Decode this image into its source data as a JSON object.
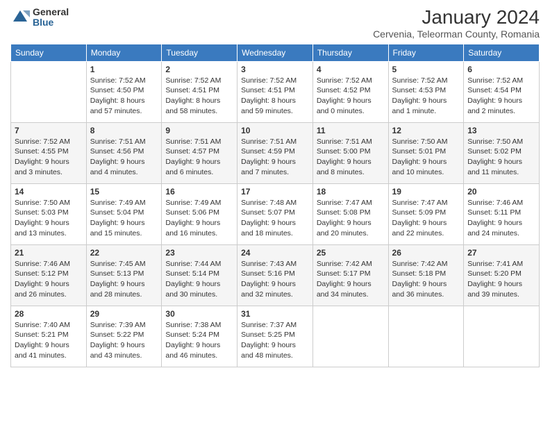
{
  "header": {
    "logo_general": "General",
    "logo_blue": "Blue",
    "main_title": "January 2024",
    "subtitle": "Cervenia, Teleorman County, Romania"
  },
  "calendar": {
    "weekdays": [
      "Sunday",
      "Monday",
      "Tuesday",
      "Wednesday",
      "Thursday",
      "Friday",
      "Saturday"
    ],
    "weeks": [
      [
        {
          "day": "",
          "info": ""
        },
        {
          "day": "1",
          "info": "Sunrise: 7:52 AM\nSunset: 4:50 PM\nDaylight: 8 hours\nand 57 minutes."
        },
        {
          "day": "2",
          "info": "Sunrise: 7:52 AM\nSunset: 4:51 PM\nDaylight: 8 hours\nand 58 minutes."
        },
        {
          "day": "3",
          "info": "Sunrise: 7:52 AM\nSunset: 4:51 PM\nDaylight: 8 hours\nand 59 minutes."
        },
        {
          "day": "4",
          "info": "Sunrise: 7:52 AM\nSunset: 4:52 PM\nDaylight: 9 hours\nand 0 minutes."
        },
        {
          "day": "5",
          "info": "Sunrise: 7:52 AM\nSunset: 4:53 PM\nDaylight: 9 hours\nand 1 minute."
        },
        {
          "day": "6",
          "info": "Sunrise: 7:52 AM\nSunset: 4:54 PM\nDaylight: 9 hours\nand 2 minutes."
        }
      ],
      [
        {
          "day": "7",
          "info": "Sunrise: 7:52 AM\nSunset: 4:55 PM\nDaylight: 9 hours\nand 3 minutes."
        },
        {
          "day": "8",
          "info": "Sunrise: 7:51 AM\nSunset: 4:56 PM\nDaylight: 9 hours\nand 4 minutes."
        },
        {
          "day": "9",
          "info": "Sunrise: 7:51 AM\nSunset: 4:57 PM\nDaylight: 9 hours\nand 6 minutes."
        },
        {
          "day": "10",
          "info": "Sunrise: 7:51 AM\nSunset: 4:59 PM\nDaylight: 9 hours\nand 7 minutes."
        },
        {
          "day": "11",
          "info": "Sunrise: 7:51 AM\nSunset: 5:00 PM\nDaylight: 9 hours\nand 8 minutes."
        },
        {
          "day": "12",
          "info": "Sunrise: 7:50 AM\nSunset: 5:01 PM\nDaylight: 9 hours\nand 10 minutes."
        },
        {
          "day": "13",
          "info": "Sunrise: 7:50 AM\nSunset: 5:02 PM\nDaylight: 9 hours\nand 11 minutes."
        }
      ],
      [
        {
          "day": "14",
          "info": "Sunrise: 7:50 AM\nSunset: 5:03 PM\nDaylight: 9 hours\nand 13 minutes."
        },
        {
          "day": "15",
          "info": "Sunrise: 7:49 AM\nSunset: 5:04 PM\nDaylight: 9 hours\nand 15 minutes."
        },
        {
          "day": "16",
          "info": "Sunrise: 7:49 AM\nSunset: 5:06 PM\nDaylight: 9 hours\nand 16 minutes."
        },
        {
          "day": "17",
          "info": "Sunrise: 7:48 AM\nSunset: 5:07 PM\nDaylight: 9 hours\nand 18 minutes."
        },
        {
          "day": "18",
          "info": "Sunrise: 7:47 AM\nSunset: 5:08 PM\nDaylight: 9 hours\nand 20 minutes."
        },
        {
          "day": "19",
          "info": "Sunrise: 7:47 AM\nSunset: 5:09 PM\nDaylight: 9 hours\nand 22 minutes."
        },
        {
          "day": "20",
          "info": "Sunrise: 7:46 AM\nSunset: 5:11 PM\nDaylight: 9 hours\nand 24 minutes."
        }
      ],
      [
        {
          "day": "21",
          "info": "Sunrise: 7:46 AM\nSunset: 5:12 PM\nDaylight: 9 hours\nand 26 minutes."
        },
        {
          "day": "22",
          "info": "Sunrise: 7:45 AM\nSunset: 5:13 PM\nDaylight: 9 hours\nand 28 minutes."
        },
        {
          "day": "23",
          "info": "Sunrise: 7:44 AM\nSunset: 5:14 PM\nDaylight: 9 hours\nand 30 minutes."
        },
        {
          "day": "24",
          "info": "Sunrise: 7:43 AM\nSunset: 5:16 PM\nDaylight: 9 hours\nand 32 minutes."
        },
        {
          "day": "25",
          "info": "Sunrise: 7:42 AM\nSunset: 5:17 PM\nDaylight: 9 hours\nand 34 minutes."
        },
        {
          "day": "26",
          "info": "Sunrise: 7:42 AM\nSunset: 5:18 PM\nDaylight: 9 hours\nand 36 minutes."
        },
        {
          "day": "27",
          "info": "Sunrise: 7:41 AM\nSunset: 5:20 PM\nDaylight: 9 hours\nand 39 minutes."
        }
      ],
      [
        {
          "day": "28",
          "info": "Sunrise: 7:40 AM\nSunset: 5:21 PM\nDaylight: 9 hours\nand 41 minutes."
        },
        {
          "day": "29",
          "info": "Sunrise: 7:39 AM\nSunset: 5:22 PM\nDaylight: 9 hours\nand 43 minutes."
        },
        {
          "day": "30",
          "info": "Sunrise: 7:38 AM\nSunset: 5:24 PM\nDaylight: 9 hours\nand 46 minutes."
        },
        {
          "day": "31",
          "info": "Sunrise: 7:37 AM\nSunset: 5:25 PM\nDaylight: 9 hours\nand 48 minutes."
        },
        {
          "day": "",
          "info": ""
        },
        {
          "day": "",
          "info": ""
        },
        {
          "day": "",
          "info": ""
        }
      ]
    ]
  }
}
